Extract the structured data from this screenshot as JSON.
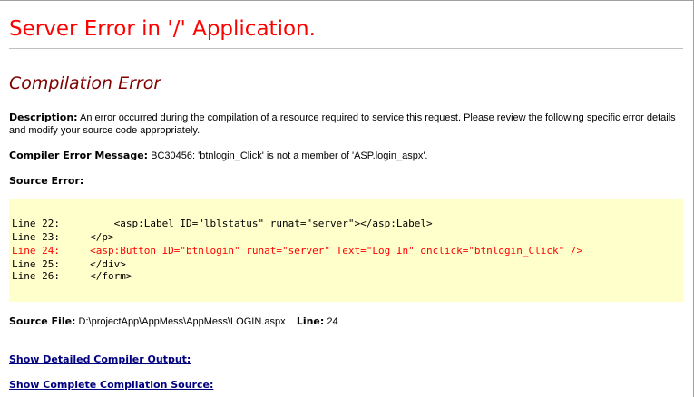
{
  "title": "Server Error in '/' Application.",
  "subtitle": "Compilation Error",
  "description": {
    "label": "Description:",
    "text": "An error occurred during the compilation of a resource required to service this request. Please review the following specific error details and modify your source code appropriately."
  },
  "compiler_error": {
    "label": "Compiler Error Message:",
    "text": "BC30456: 'btnlogin_Click' is not a member of 'ASP.login_aspx'."
  },
  "source_error": {
    "label": "Source Error:",
    "lines": [
      {
        "text": "Line 22:         <asp:Label ID=\"lblstatus\" runat=\"server\"></asp:Label>",
        "highlighted": false
      },
      {
        "text": "Line 23:     </p>",
        "highlighted": false
      },
      {
        "text": "Line 24:     <asp:Button ID=\"btnlogin\" runat=\"server\" Text=\"Log In\" onclick=\"btnlogin_Click\" />",
        "highlighted": true
      },
      {
        "text": "Line 25:     </div>",
        "highlighted": false
      },
      {
        "text": "Line 26:     </form>",
        "highlighted": false
      }
    ]
  },
  "source_file": {
    "label": "Source File:",
    "path": "D:\\projectApp\\AppMess\\AppMess\\LOGIN.aspx",
    "line_label": "Line:",
    "line_number": "24"
  },
  "links": {
    "detailed_output": "Show Detailed Compiler Output:",
    "complete_source": "Show Complete Compilation Source:"
  },
  "colors": {
    "title": "#ff0000",
    "subtitle": "#800000",
    "code_background": "#ffffcc",
    "error_line": "#ff0000",
    "link": "#000080"
  }
}
